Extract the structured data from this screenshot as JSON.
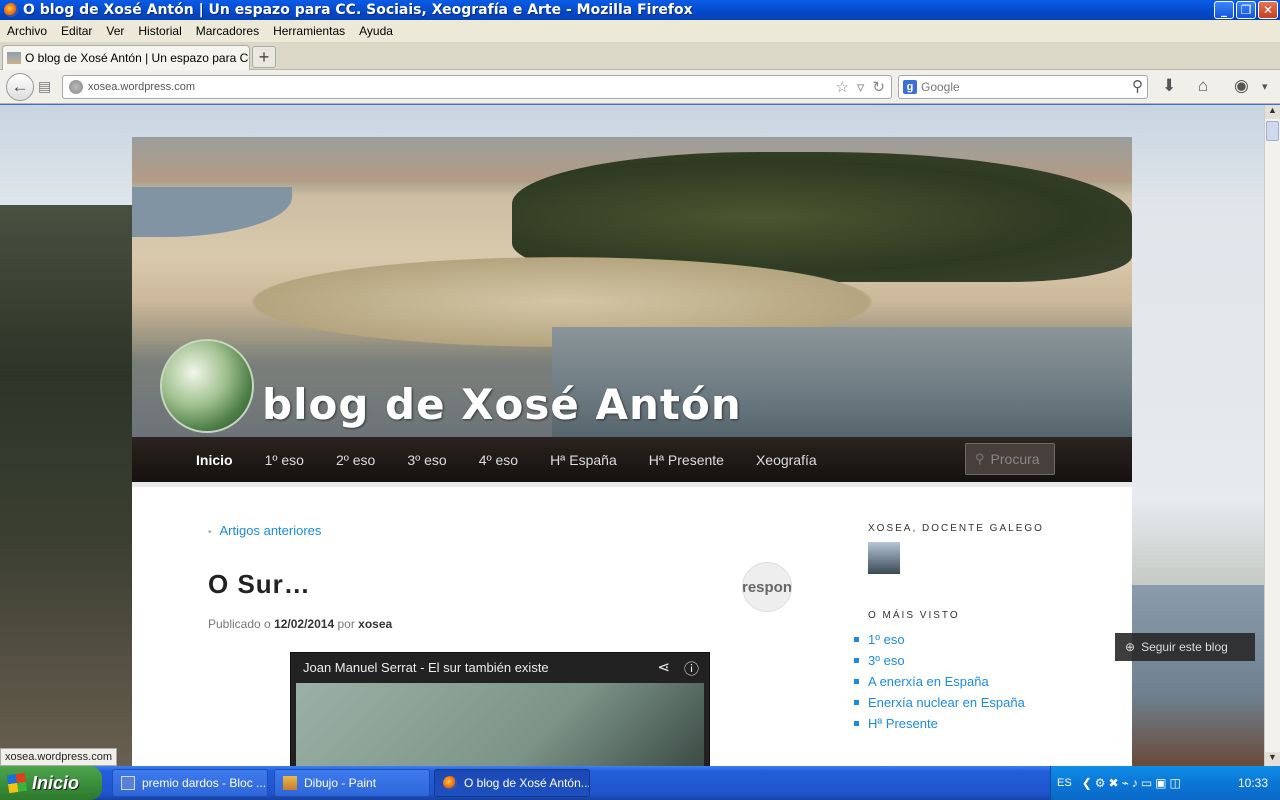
{
  "window": {
    "title": "O blog de Xosé Antón | Un espazo para CC. Sociais, Xeografía e Arte - Mozilla Firefox"
  },
  "menubar": [
    "Archivo",
    "Editar",
    "Ver",
    "Historial",
    "Marcadores",
    "Herramientas",
    "Ayuda"
  ],
  "tabs": [
    {
      "label": "O blog de Xosé Antón | Un espazo para CC. ..."
    }
  ],
  "navbar": {
    "url": "xosea.wordpress.com",
    "search_engine": "Google",
    "search_placeholder": "Google"
  },
  "site": {
    "title": "blog de Xosé Antón",
    "nav": [
      "Inicio",
      "1º eso",
      "2º eso",
      "3º eso",
      "4º eso",
      "Hª España",
      "Hª Presente",
      "Xeografía"
    ],
    "search_placeholder": "Procura"
  },
  "post": {
    "prev_link": "Artigos anteriores",
    "title": "O Sur…",
    "comment_bubble": "respon",
    "meta_prefix": "Publicado o",
    "date": "12/02/2014",
    "by": "por",
    "author": "xosea",
    "video_title": "Joan Manuel Serrat - El sur también existe"
  },
  "sidebar": {
    "widget1_title": "XOSEA, DOCENTE GALEGO",
    "widget2_title": "O MÁIS VISTO",
    "top_posts": [
      "1º eso",
      "3º eso",
      "A enerxía en España",
      "Enerxía nuclear en España",
      "Hª Presente"
    ]
  },
  "follow_button": "Seguir este blog",
  "status_bar": "xosea.wordpress.com",
  "taskbar": {
    "start": "Inicio",
    "tasks": [
      "premio dardos - Bloc ...",
      "Dibujo - Paint",
      "O blog de Xosé Antón..."
    ],
    "lang": "ES",
    "clock": "10:33"
  }
}
